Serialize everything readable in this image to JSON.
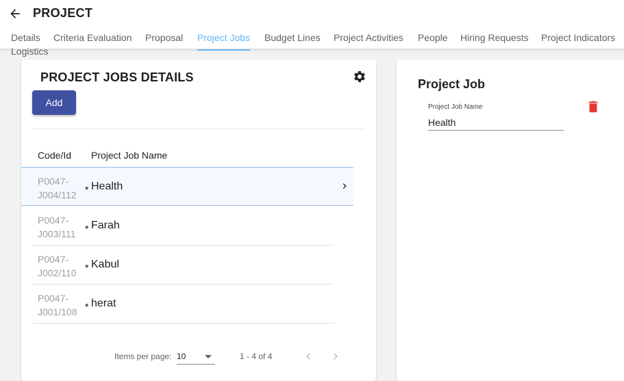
{
  "header": {
    "title": "PROJECT",
    "back_icon": "arrow-left-icon"
  },
  "tabs": [
    {
      "label": "Details"
    },
    {
      "label": "Criteria Evaluation"
    },
    {
      "label": "Proposal"
    },
    {
      "label": "Project Jobs",
      "active": true
    },
    {
      "label": "Budget Lines"
    },
    {
      "label": "Project Activities"
    },
    {
      "label": "People"
    },
    {
      "label": "Hiring Requests"
    },
    {
      "label": "Project Indicators"
    },
    {
      "label": "Logistics"
    }
  ],
  "list_panel": {
    "title": "PROJECT JOBS DETAILS",
    "add_label": "Add",
    "columns": {
      "code": "Code/Id",
      "name": "Project Job Name"
    },
    "rows": [
      {
        "code_line1": "P0047-",
        "code_line2": "J004/112",
        "name": "Health",
        "selected": true
      },
      {
        "code_line1": "P0047-",
        "code_line2": "J003/111",
        "name": "Farah"
      },
      {
        "code_line1": "P0047-",
        "code_line2": "J002/110",
        "name": "Kabul"
      },
      {
        "code_line1": "P0047-",
        "code_line2": "J001/108",
        "name": "herat"
      }
    ],
    "pager": {
      "items_per_page_label": "Items per page:",
      "items_per_page": "10",
      "range": "1 - 4 of 4"
    }
  },
  "detail_panel": {
    "title": "Project Job",
    "field_label": "Project Job Name",
    "field_value": "Health"
  },
  "colors": {
    "accent": "#64b5f6",
    "primary_button": "#3f51a0",
    "delete": "#e53935"
  }
}
